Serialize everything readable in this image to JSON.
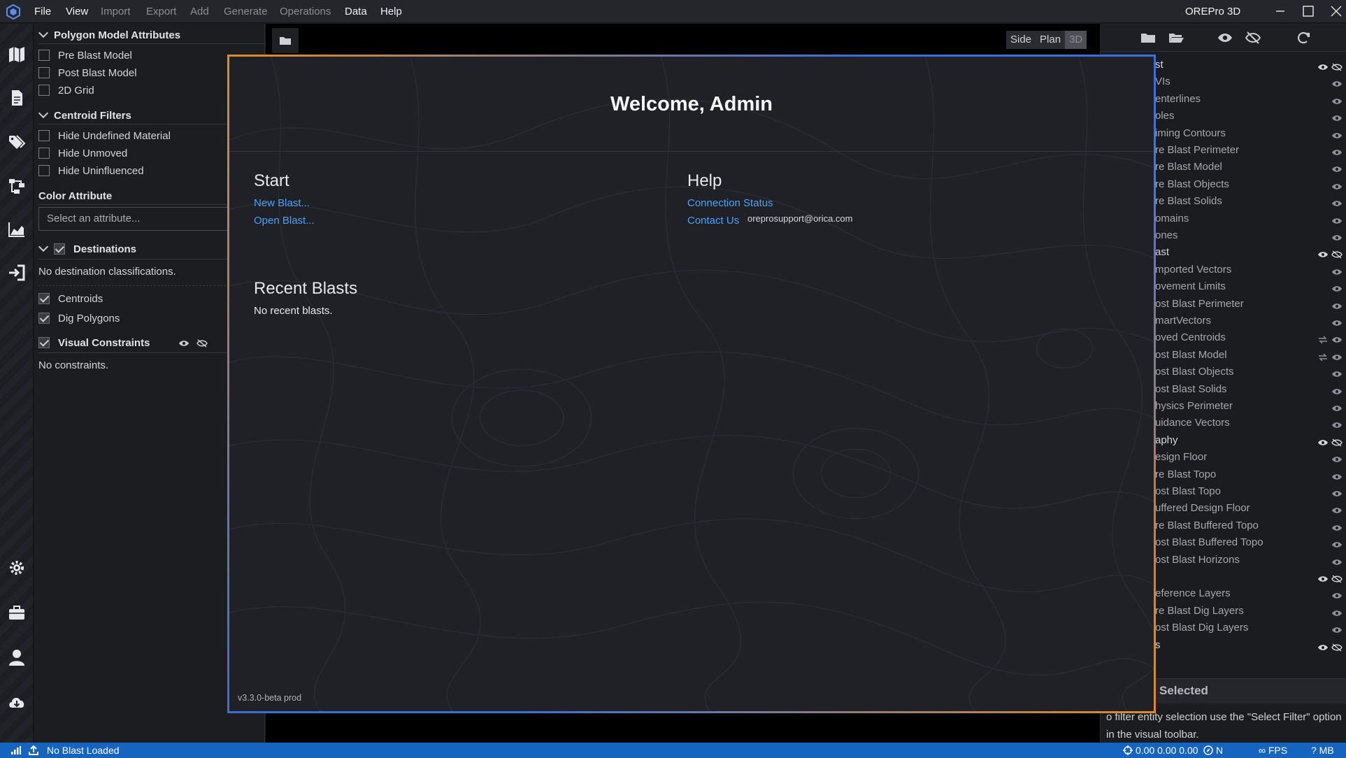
{
  "titlebar": {
    "menus": [
      "File",
      "View",
      "Import",
      "Export",
      "Add",
      "Generate",
      "Operations",
      "Data",
      "Help"
    ],
    "app_title": "OREPro 3D"
  },
  "left_panel": {
    "polygon_model": {
      "title": "Polygon Model Attributes",
      "items": [
        {
          "label": "Pre Blast Model",
          "checked": false
        },
        {
          "label": "Post Blast Model",
          "checked": false
        },
        {
          "label": "2D Grid",
          "checked": false
        }
      ]
    },
    "centroid_filters": {
      "title": "Centroid Filters",
      "items": [
        {
          "label": "Hide Undefined Material",
          "checked": false
        },
        {
          "label": "Hide Unmoved",
          "checked": false
        },
        {
          "label": "Hide Uninfluenced",
          "checked": false
        }
      ]
    },
    "color_attribute": {
      "title": "Color Attribute",
      "placeholder": "Select an attribute..."
    },
    "destinations": {
      "title": "Destinations",
      "empty": "No destination classifications.",
      "items": [
        {
          "label": "Centroids",
          "checked": true
        },
        {
          "label": "Dig Polygons",
          "checked": true
        }
      ]
    },
    "visual_constraints": {
      "title": "Visual Constraints",
      "empty": "No constraints."
    }
  },
  "viewport": {
    "view_modes": [
      "Side",
      "Plan",
      "3D"
    ],
    "active_view": "3D"
  },
  "right_panel": {
    "layers": [
      {
        "label": "st",
        "group": true,
        "icons": "both"
      },
      {
        "label": "VIs",
        "icons": "eye"
      },
      {
        "label": "enterlines",
        "icons": "eye"
      },
      {
        "label": "oles",
        "icons": "eye"
      },
      {
        "label": "iming Contours",
        "icons": "eye"
      },
      {
        "label": "re Blast Perimeter",
        "icons": "eye"
      },
      {
        "label": "re Blast Model",
        "icons": "eye"
      },
      {
        "label": "re Blast Objects",
        "icons": "eye"
      },
      {
        "label": "re Blast Solids",
        "icons": "eye"
      },
      {
        "label": "omains",
        "icons": "eye"
      },
      {
        "label": "ones",
        "icons": "eye"
      },
      {
        "label": "ast",
        "group": true,
        "icons": "both"
      },
      {
        "label": "mported Vectors",
        "icons": "eye"
      },
      {
        "label": "ovement Limits",
        "icons": "eye"
      },
      {
        "label": "ost Blast Perimeter",
        "icons": "eye"
      },
      {
        "label": "martVectors",
        "icons": "eye"
      },
      {
        "label": "oved Centroids",
        "icons": "swap"
      },
      {
        "label": "ost Blast Model",
        "icons": "swap"
      },
      {
        "label": "ost Blast Objects",
        "icons": "eye"
      },
      {
        "label": "ost Blast Solids",
        "icons": "eye"
      },
      {
        "label": "hysics Perimeter",
        "icons": "eye"
      },
      {
        "label": "uidance Vectors",
        "icons": "eye"
      },
      {
        "label": "aphy",
        "group": true,
        "icons": "both"
      },
      {
        "label": "esign Floor",
        "icons": "eye"
      },
      {
        "label": "re Blast Topo",
        "icons": "eye"
      },
      {
        "label": "ost Blast Topo",
        "icons": "eye"
      },
      {
        "label": "uffered Design Floor",
        "icons": "eye"
      },
      {
        "label": "re Blast Buffered Topo",
        "icons": "eye"
      },
      {
        "label": "ost Blast Buffered Topo",
        "icons": "eye"
      },
      {
        "label": "ost Blast Horizons",
        "icons": "eye"
      },
      {
        "label": "",
        "group": true,
        "icons": "both"
      },
      {
        "label": "eference Layers",
        "icons": "eye"
      },
      {
        "label": "re Blast Dig Layers",
        "icons": "eye"
      },
      {
        "label": "ost Blast Dig Layers",
        "icons": "eye"
      },
      {
        "label": "s",
        "group": true,
        "icons": "both"
      }
    ],
    "selected_title": "Selected",
    "selected_desc": "o filter entity selection use the \"Select Filter\" option in the visual toolbar."
  },
  "welcome": {
    "title": "Welcome, Admin",
    "start_title": "Start",
    "new_blast": "New Blast...",
    "open_blast": "Open Blast...",
    "help_title": "Help",
    "connection_status": "Connection Status",
    "contact_us": "Contact Us",
    "email": "oreprosupport@orica.com",
    "recent_title": "Recent Blasts",
    "recent_empty": "No recent blasts.",
    "version": "v3.3.0-beta prod"
  },
  "statusbar": {
    "blast_status": "No Blast Loaded",
    "coords": "0.00 0.00 0.00",
    "north": "N",
    "fps": "∞ FPS",
    "memory": "? MB"
  },
  "colors": {
    "accent_blue": "#1565c0",
    "link": "#4aa3f5",
    "modal_border_orange": "#e08a2a",
    "modal_border_blue": "#3a6fd8"
  }
}
